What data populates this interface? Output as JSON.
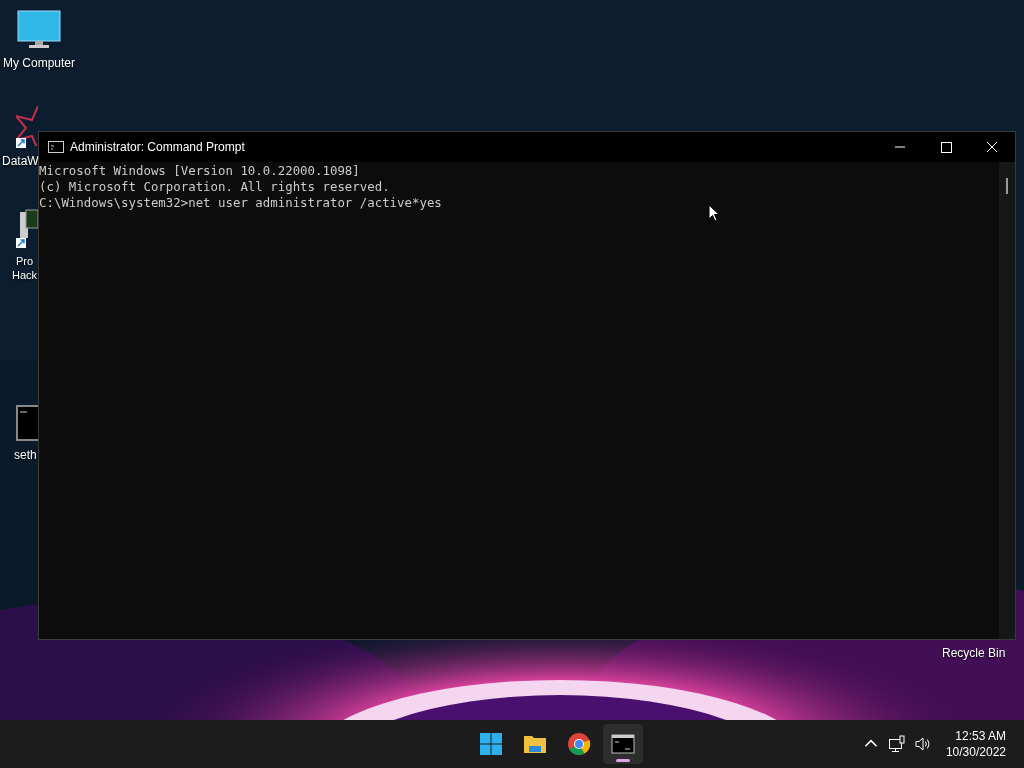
{
  "desktop_icons": [
    {
      "kind": "monitor",
      "lines": [
        "My Computer"
      ],
      "shortcut": false
    },
    {
      "kind": "star",
      "lines": [
        "DataW"
      ],
      "shortcut": true
    },
    {
      "kind": "hacker",
      "lines": [
        "Pro",
        "Hack"
      ],
      "shortcut": true
    },
    {
      "kind": "console",
      "lines": [
        "seth"
      ],
      "shortcut": false
    },
    {
      "kind": "recycle",
      "lines": [
        "Recycle Bin"
      ],
      "shortcut": false
    }
  ],
  "window": {
    "title": "Administrator: Command Prompt",
    "lines": [
      "Microsoft Windows [Version 10.0.22000.1098]",
      "(c) Microsoft Corporation. All rights reserved.",
      "C:\\Windows\\system32>net user administrator /active*yes"
    ]
  },
  "taskbar": {
    "apps": [
      {
        "kind": "start",
        "selected": false
      },
      {
        "kind": "folder",
        "selected": false
      },
      {
        "kind": "chrome",
        "selected": false
      },
      {
        "kind": "console",
        "selected": true
      }
    ],
    "time": "12:53 AM",
    "date": "10/30/2022"
  }
}
